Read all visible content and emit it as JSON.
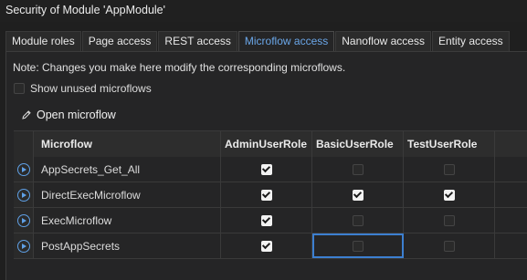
{
  "window": {
    "title": "Security of Module 'AppModule'"
  },
  "tabs": [
    {
      "label": "Module roles"
    },
    {
      "label": "Page access"
    },
    {
      "label": "REST access"
    },
    {
      "label": "Microflow access",
      "active": true
    },
    {
      "label": "Nanoflow access"
    },
    {
      "label": "Entity access"
    }
  ],
  "note": "Note: Changes you make here modify the corresponding microflows.",
  "show_unused": {
    "label": "Show unused microflows",
    "checked": false
  },
  "toolbar": {
    "open_label": "Open microflow",
    "open_icon": "pencil-icon"
  },
  "grid": {
    "columns": [
      "Microflow",
      "AdminUserRole",
      "BasicUserRole",
      "TestUserRole"
    ],
    "rows": [
      {
        "name": "AppSecrets_Get_All",
        "admin": true,
        "basic": false,
        "test": false
      },
      {
        "name": "DirectExecMicroflow",
        "admin": true,
        "basic": true,
        "test": true
      },
      {
        "name": "ExecMicroflow",
        "admin": true,
        "basic": false,
        "test": false
      },
      {
        "name": "PostAppSecrets",
        "admin": true,
        "basic": false,
        "test": false
      }
    ]
  },
  "colors": {
    "accent": "#6aa6e8",
    "focus": "#3c7fd0",
    "background": "#1f1f1f"
  }
}
